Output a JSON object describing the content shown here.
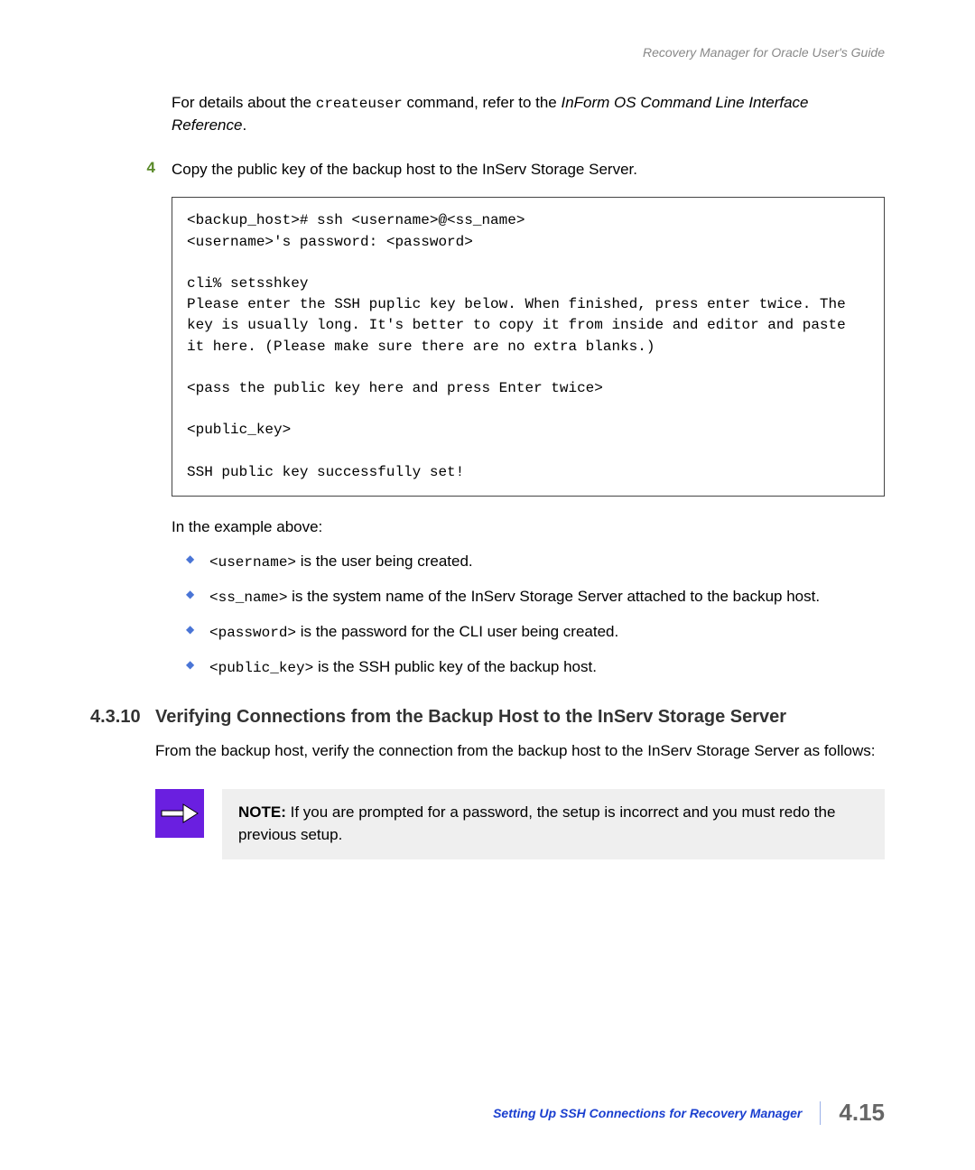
{
  "header": {
    "doc_title": "Recovery Manager for Oracle User's Guide"
  },
  "continuation": {
    "text_before_code": "For details about the ",
    "code": "createuser",
    "text_after_code": " command, refer to the ",
    "italic_ref": "InForm OS Command Line Interface Reference",
    "text_end": "."
  },
  "step4": {
    "num": "4",
    "text": "Copy the public key of the backup host to the InServ Storage Server."
  },
  "code_block": "<backup_host># ssh <username>@<ss_name>\n<username>'s password: <password>\n\ncli% setsshkey\nPlease enter the SSH puplic key below. When finished, press enter twice. The key is usually long. It's better to copy it from inside and editor and paste it here. (Please make sure there are no extra blanks.)\n\n<pass the public key here and press Enter twice>\n\n<public_key>\n\nSSH public key successfully set!",
  "example_intro": "In the example above:",
  "bullets": [
    {
      "code": "<username>",
      "rest": " is the user being created."
    },
    {
      "code": "<ss_name>",
      "rest": " is the system name of the InServ Storage Server attached to the backup host."
    },
    {
      "code": "<password>",
      "rest": " is the password for the CLI user being created."
    },
    {
      "code": "<public_key>",
      "rest": " is the SSH public key of the backup host."
    }
  ],
  "section": {
    "num": "4.3.10",
    "title": "Verifying Connections from the Backup Host to the InServ Storage Server",
    "para": "From the backup host, verify the connection from the backup host to the InServ Storage Server as follows:"
  },
  "note": {
    "label": "NOTE:",
    "text": " If you are prompted for a password, the setup is incorrect and you must redo the previous setup."
  },
  "footer": {
    "section_label": "Setting Up SSH Connections for Recovery Manager",
    "page": "4.15"
  }
}
